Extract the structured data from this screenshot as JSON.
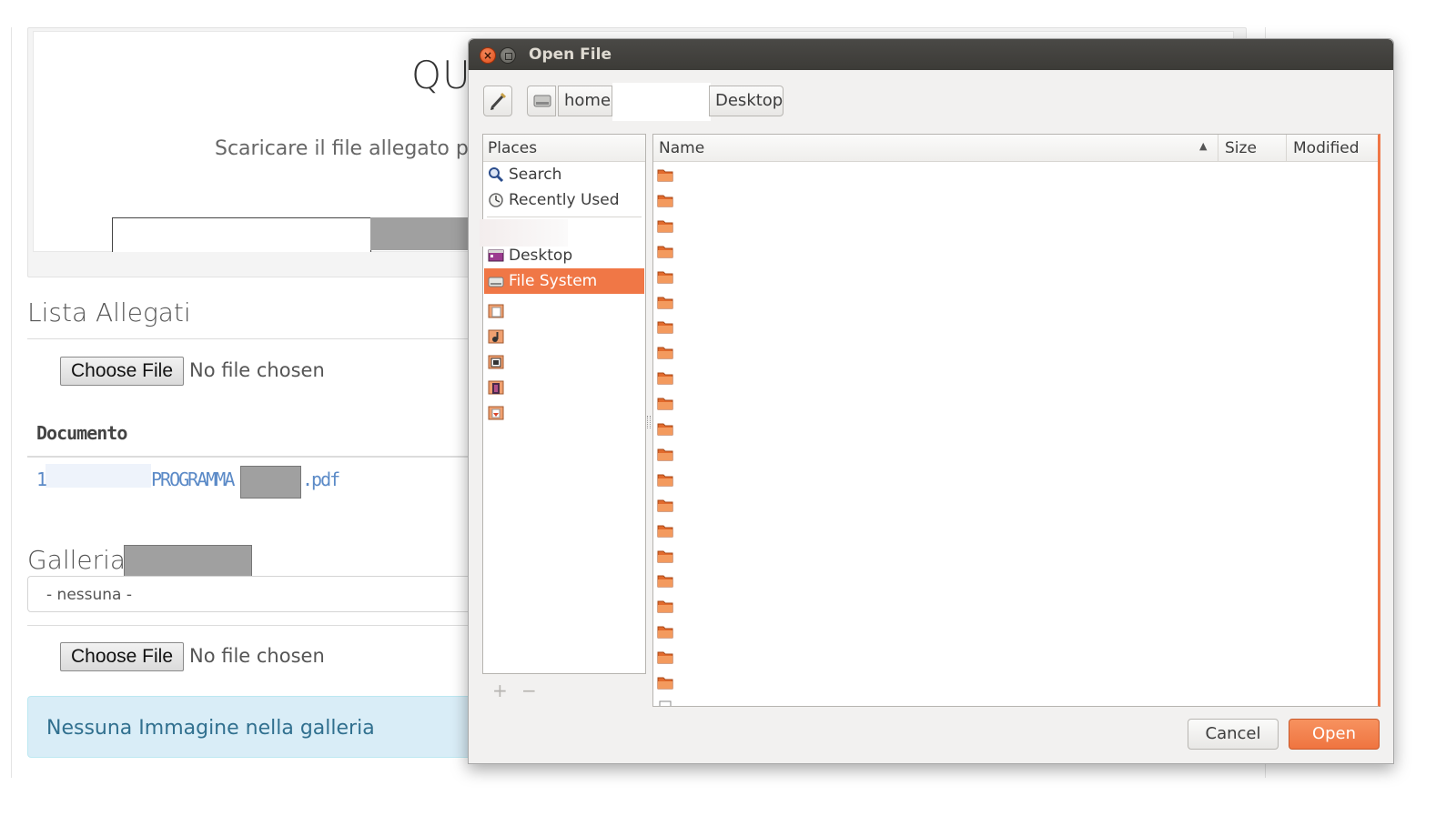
{
  "web": {
    "quiz_title": "QU",
    "quiz_subtitle": "Scaricare il file allegato per",
    "lista_heading": "Lista Allegati",
    "choose_file_label": "Choose File",
    "no_file_chosen": "No file chosen",
    "documento_header": "Documento",
    "doc_prefix": "1",
    "doc_mid": "PROGRAMMA",
    "doc_ext": ".pdf",
    "galleria_heading": "Galleria",
    "galleria_select_value": "- nessuna -",
    "galleria_empty_message": "Nessuna Immagine nella galleria"
  },
  "dialog": {
    "title": "Open File",
    "path": {
      "home": "home",
      "desktop": "Desktop"
    },
    "places_header": "Places",
    "places": [
      {
        "label": "Search",
        "icon": "search-icon"
      },
      {
        "label": "Recently Used",
        "icon": "clock-icon"
      },
      {
        "label": "Desktop",
        "icon": "desktop-icon"
      },
      {
        "label": "File System",
        "icon": "drive-icon",
        "selected": true
      }
    ],
    "bookmark_icons": [
      "documents-icon",
      "music-icon",
      "pictures-icon",
      "videos-icon",
      "downloads-icon"
    ],
    "add_symbol": "+",
    "remove_symbol": "−",
    "columns": {
      "name": "Name",
      "size": "Size",
      "modified": "Modified"
    },
    "folder_rows": 21,
    "cancel_label": "Cancel",
    "open_label": "Open"
  },
  "colors": {
    "accent": "#f07746",
    "titlebar": "#3c3b37",
    "link": "#5b8ac7",
    "alert_bg": "#d9edf7"
  }
}
